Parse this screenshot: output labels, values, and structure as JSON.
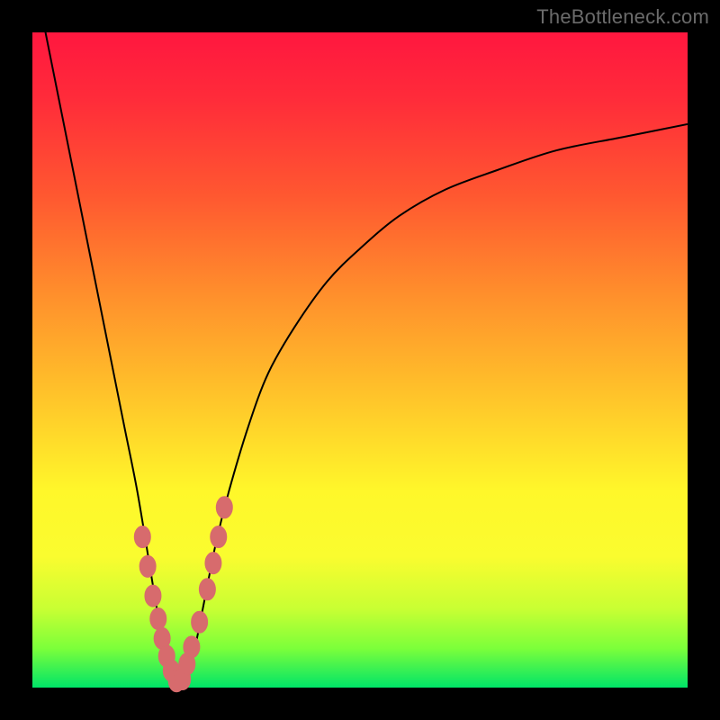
{
  "watermark": "TheBottleneck.com",
  "chart_data": {
    "type": "line",
    "title": "",
    "xlabel": "",
    "ylabel": "",
    "xlim": [
      0,
      100
    ],
    "ylim": [
      0,
      100
    ],
    "series": [
      {
        "name": "bottleneck-curve",
        "x": [
          0,
          2,
          4,
          6,
          8,
          10,
          12,
          14,
          16,
          18,
          19,
          20,
          21,
          22,
          23,
          24,
          25,
          26,
          28,
          30,
          33,
          36,
          40,
          45,
          50,
          56,
          63,
          71,
          80,
          90,
          100
        ],
        "values": [
          110,
          100,
          90,
          80,
          70,
          60,
          50,
          40,
          30,
          18,
          12,
          7,
          3,
          1,
          1,
          3,
          7,
          12,
          22,
          30,
          40,
          48,
          55,
          62,
          67,
          72,
          76,
          79,
          82,
          84,
          86
        ]
      }
    ],
    "markers": {
      "name": "highlight-dots",
      "x": [
        16.8,
        17.6,
        18.4,
        19.2,
        19.8,
        20.5,
        21.2,
        22.0,
        22.9,
        23.6,
        24.3,
        25.5,
        26.7,
        27.6,
        28.4,
        29.3
      ],
      "values": [
        23.0,
        18.5,
        14.0,
        10.5,
        7.5,
        4.8,
        2.6,
        1.0,
        1.3,
        3.6,
        6.2,
        10.0,
        15.0,
        19.0,
        23.0,
        27.5
      ]
    }
  }
}
